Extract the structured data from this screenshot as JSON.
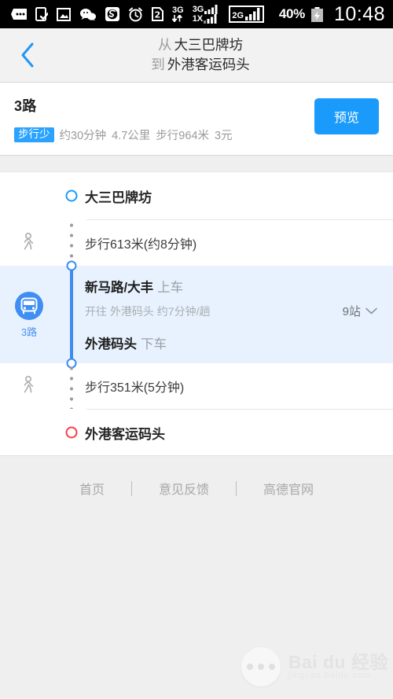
{
  "status_bar": {
    "icons": [
      "messages-icon",
      "phone-check-icon",
      "photo-icon",
      "wechat-icon",
      "sogou-icon",
      "alarm-clock-icon",
      "sim2-icon",
      "3g-data-icon",
      "3g-1x-signal-icon",
      "2g-signal-icon"
    ],
    "battery_percent": "40%",
    "battery_icon": "battery-charging-icon",
    "time": "10:48"
  },
  "header": {
    "back_icon": "chevron-left-icon",
    "from_prefix": "从",
    "from": "大三巴牌坊",
    "to_prefix": "到",
    "to": "外港客运码头"
  },
  "summary": {
    "route_name": "3路",
    "badge": "步行少",
    "duration": "约30分钟",
    "distance": "4.7公里",
    "walking": "步行964米",
    "price": "3元",
    "preview_label": "预览",
    "accent_color": "#1a9bfc"
  },
  "steps": [
    {
      "kind": "point",
      "node": "start",
      "name": "大三巴牌坊"
    },
    {
      "kind": "walk",
      "mode_icon": "pedestrian-icon",
      "text": "步行613米(约8分钟)"
    },
    {
      "kind": "bus",
      "mode_icon": "bus-icon",
      "mode_label": "3路",
      "board_stop": "新马路/大丰",
      "board_action": "上车",
      "direction": "开往 外港码头  约7分钟/趟",
      "alight_stop": "外港码头",
      "alight_action": "下车",
      "stops_count": "9站",
      "expand_icon": "chevron-down-icon",
      "highlight_color": "#e8f2fe"
    },
    {
      "kind": "walk",
      "mode_icon": "pedestrian-icon",
      "text": "步行351米(5分钟)"
    },
    {
      "kind": "point",
      "node": "end",
      "name": "外港客运码头"
    }
  ],
  "footer": {
    "links": [
      "首页",
      "意见反馈",
      "高德官网"
    ],
    "separator": "|"
  },
  "watermark": {
    "brand": "Bai du 经验",
    "url": "jingyan.baidu.com",
    "dots_icon": "more-dots-icon"
  }
}
